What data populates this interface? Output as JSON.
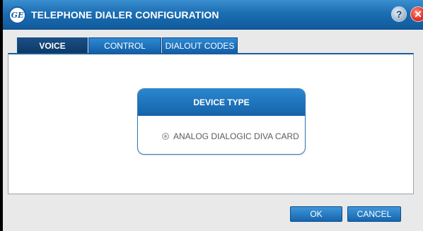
{
  "window": {
    "title": "TELEPHONE DIALER CONFIGURATION",
    "logo_text": "GE",
    "help_symbol": "?",
    "close_symbol": "✕"
  },
  "tabs": [
    {
      "label": "VOICE",
      "active": true
    },
    {
      "label": "CONTROL",
      "active": false
    },
    {
      "label": "DIALOUT CODES",
      "active": false
    }
  ],
  "device_type": {
    "header": "DEVICE TYPE",
    "option_label": "ANALOG DIALOGIC DIVA CARD",
    "option_selected": false
  },
  "buttons": {
    "ok": "OK",
    "cancel": "CANCEL"
  },
  "icons": [
    "ge-logo-icon",
    "help-icon",
    "close-icon",
    "radio-button-icon"
  ],
  "colors": {
    "titlebar": "#1c6db2",
    "tab": "#1e78c2",
    "tab_active": "#154574",
    "close": "#e2302b"
  }
}
